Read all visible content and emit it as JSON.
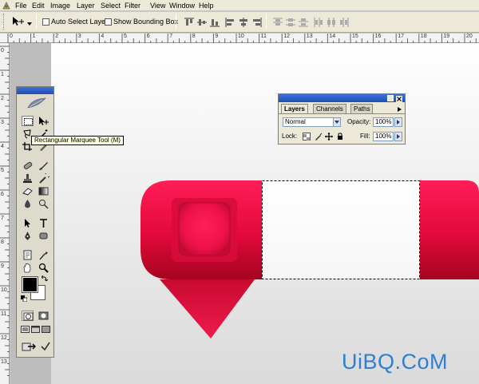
{
  "menu": {
    "items": [
      "File",
      "Edit",
      "Image",
      "Layer",
      "Select",
      "Filter",
      "View",
      "Window",
      "Help"
    ]
  },
  "options_bar": {
    "auto_select_label": "Auto Select Layer",
    "bounding_box_label": "Show Bounding Box"
  },
  "rulers": {
    "horizontal": [
      "0",
      "1",
      "2",
      "3",
      "4",
      "5",
      "6",
      "7",
      "8",
      "9",
      "10",
      "11",
      "12",
      "13",
      "14",
      "15",
      "16",
      "17",
      "18",
      "19",
      "20"
    ],
    "vertical": [
      "0",
      "1",
      "2",
      "3",
      "4",
      "5",
      "6",
      "7",
      "8",
      "9",
      "10",
      "11",
      "12",
      "13"
    ]
  },
  "tooltip": {
    "text": "Rectangular Marquee Tool (M)"
  },
  "layers_panel": {
    "tabs": [
      "Layers",
      "Channels",
      "Paths"
    ],
    "blend_mode": "Normal",
    "opacity_label": "Opacity:",
    "opacity_value": "100%",
    "lock_label": "Lock:",
    "fill_label": "Fill:",
    "fill_value": "100%"
  },
  "watermark": {
    "text": "UiBQ.CoM"
  },
  "colors": {
    "accent_red": "#e8103f",
    "titlebar_blue": "#2a5fc8",
    "watermark_blue": "#2f7fd1"
  }
}
